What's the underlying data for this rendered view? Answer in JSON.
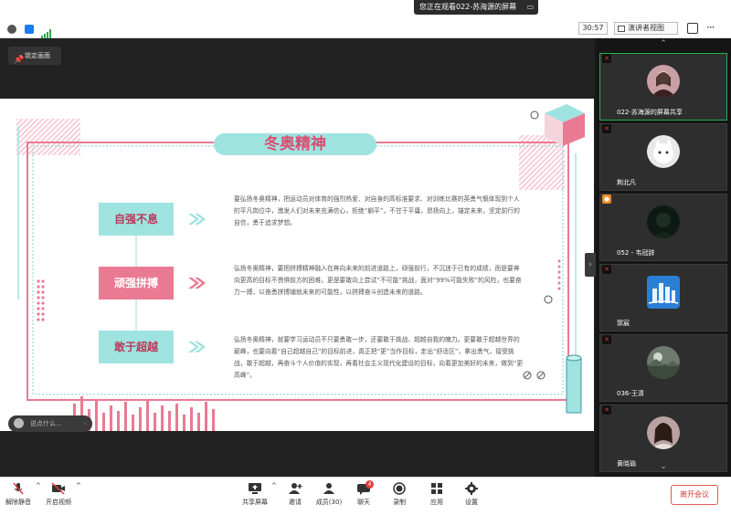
{
  "app": {
    "banner": "您正在观看022-苏海源的屏幕",
    "timer": "30:57",
    "view_mode": "演讲者视图",
    "lock_screen": "锁定画面",
    "chat_placeholder": "说点什么..."
  },
  "slide": {
    "title": "冬奥精神",
    "sections": [
      {
        "label": "自强不息",
        "text": "要弘扬冬奥精神，把运动员对体育的强烈热爱、对自身的高标准要求、对训练比赛的英勇气慨体现到个人的平凡岗位中，激发人们对未来充满信心，拒绝“躺平”，不甘于平庸，昂扬向上，锚定未来，坚定前行的自信，勇于追求梦想。"
      },
      {
        "label": "顽强拼搏",
        "text": "弘扬冬奥精神，要把拼搏精神融入在奔向未来的前进道路上，顽强前行，不沉迷于已有的成绩，而是要奔向更高的目标不畏惧前方的困难，更是要敢向上尝试“不可能”挑战，面对“99%可能失败”的风险，也要奋力一搏，以奋勇拼搏铺就未来的可能性，以拼搏奋斗创造未来的道路。"
      },
      {
        "label": "敢于超越",
        "text": "弘扬冬奥精神，就要学习运动员不只要勇敢一步，还要敢于挑战、超越自我的魄力。更要敢于超越世界的巅峰，也要向着“自己超越自己”的目标前进，真正把“更”当作目标，走出“舒适区”，拿出勇气，接受挑战，敢于超越，再奋斗个人价值的实现，再着社会主义现代化建设的目标，向着更加美好的未来，做到“更高峰”。"
      }
    ]
  },
  "participants": [
    {
      "name": "022-苏海源的屏幕共享",
      "active": true,
      "avatar": "woman-avatar"
    },
    {
      "name": "荆北凡",
      "active": false,
      "avatar": "cat-avatar"
    },
    {
      "name": "052 - 韦冠辞",
      "active": false,
      "avatar": "dark-avatar"
    },
    {
      "name": "郭宸",
      "active": false,
      "avatar": "city-avatar"
    },
    {
      "name": "036-王清",
      "active": false,
      "avatar": "landscape-avatar"
    },
    {
      "name": "黄晓瑜",
      "active": false,
      "avatar": "girl-avatar"
    }
  ],
  "toolbar": {
    "unmute": "解除静音",
    "start_video": "开启视频",
    "share_screen": "共享屏幕",
    "invite": "邀请",
    "members": "成员(30)",
    "chat": "聊天",
    "chat_badge": "4",
    "record": "录制",
    "apps": "应用",
    "settings": "设置",
    "leave": "离开会议"
  },
  "colors": {
    "teal": "#9fe3e0",
    "pink": "#ea7a93",
    "active_border": "#24b04a",
    "leave_red": "#e03c3c"
  }
}
